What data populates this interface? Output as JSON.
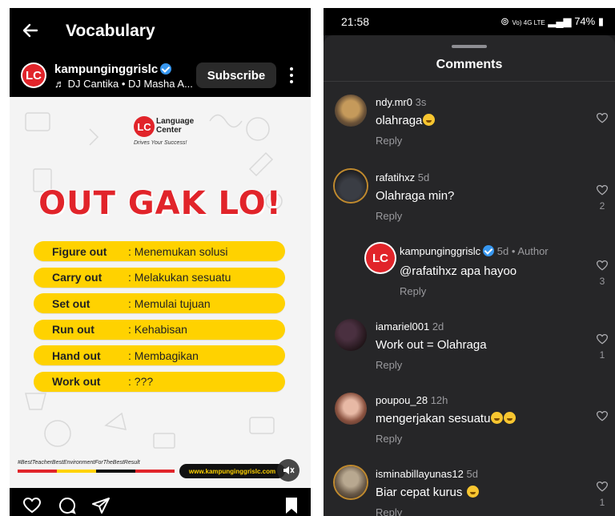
{
  "left": {
    "header": {
      "title": "Vocabulary"
    },
    "account": {
      "name": "kampunginggrislc",
      "music": "DJ Cantika • DJ Masha A...",
      "subscribe_label": "Subscribe",
      "logo_letters": "LC"
    },
    "poster": {
      "brand_line1": "Language",
      "brand_line2": "Center",
      "brand_tagline": "Drives Your Success!",
      "headline": "OUT GAK LO!",
      "items": [
        {
          "term": "Figure out",
          "definition": ": Menemukan solusi"
        },
        {
          "term": "Carry out",
          "definition": ": Melakukan sesuatu"
        },
        {
          "term": "Set out",
          "definition": ": Memulai tujuan"
        },
        {
          "term": "Run out",
          "definition": ": Kehabisan"
        },
        {
          "term": "Hand out",
          "definition": ": Membagikan"
        },
        {
          "term": "Work out",
          "definition": ": ???"
        }
      ],
      "hashtag": "#BestTeacherBestEnvironmentForTheBestResult",
      "website": "www.kampunginggrislc.com"
    }
  },
  "right": {
    "status": {
      "time": "21:58",
      "battery": "74%",
      "network": "Vo) 4G LTE"
    },
    "sheet_title": "Comments",
    "comments": [
      {
        "user": "ndy.mr0",
        "age": "3s",
        "text": "olahraga",
        "reply": "Reply",
        "likes": ""
      },
      {
        "user": "rafatihxz",
        "age": "5d",
        "text": "Olahraga min?",
        "reply": "Reply",
        "likes": "2"
      },
      {
        "user": "kampunginggrislc",
        "age": "5d",
        "author": "• Author",
        "text": "@rafatihxz apa hayoo",
        "reply": "Reply",
        "likes": "3"
      },
      {
        "user": "iamariel001",
        "age": "2d",
        "text": "Work out = Olahraga",
        "reply": "Reply",
        "likes": "1"
      },
      {
        "user": "poupou_28",
        "age": "12h",
        "text": "mengerjakan sesuatu",
        "reply": "Reply",
        "likes": ""
      },
      {
        "user": "isminabillayunas12",
        "age": "5d",
        "text": "Biar cepat kurus",
        "reply": "Reply",
        "likes": "1"
      }
    ]
  },
  "colors": {
    "brand_red": "#e1242a",
    "highlight_yellow": "#ffd200",
    "verified_blue": "#3797f0",
    "sheet_bg": "#262628"
  }
}
